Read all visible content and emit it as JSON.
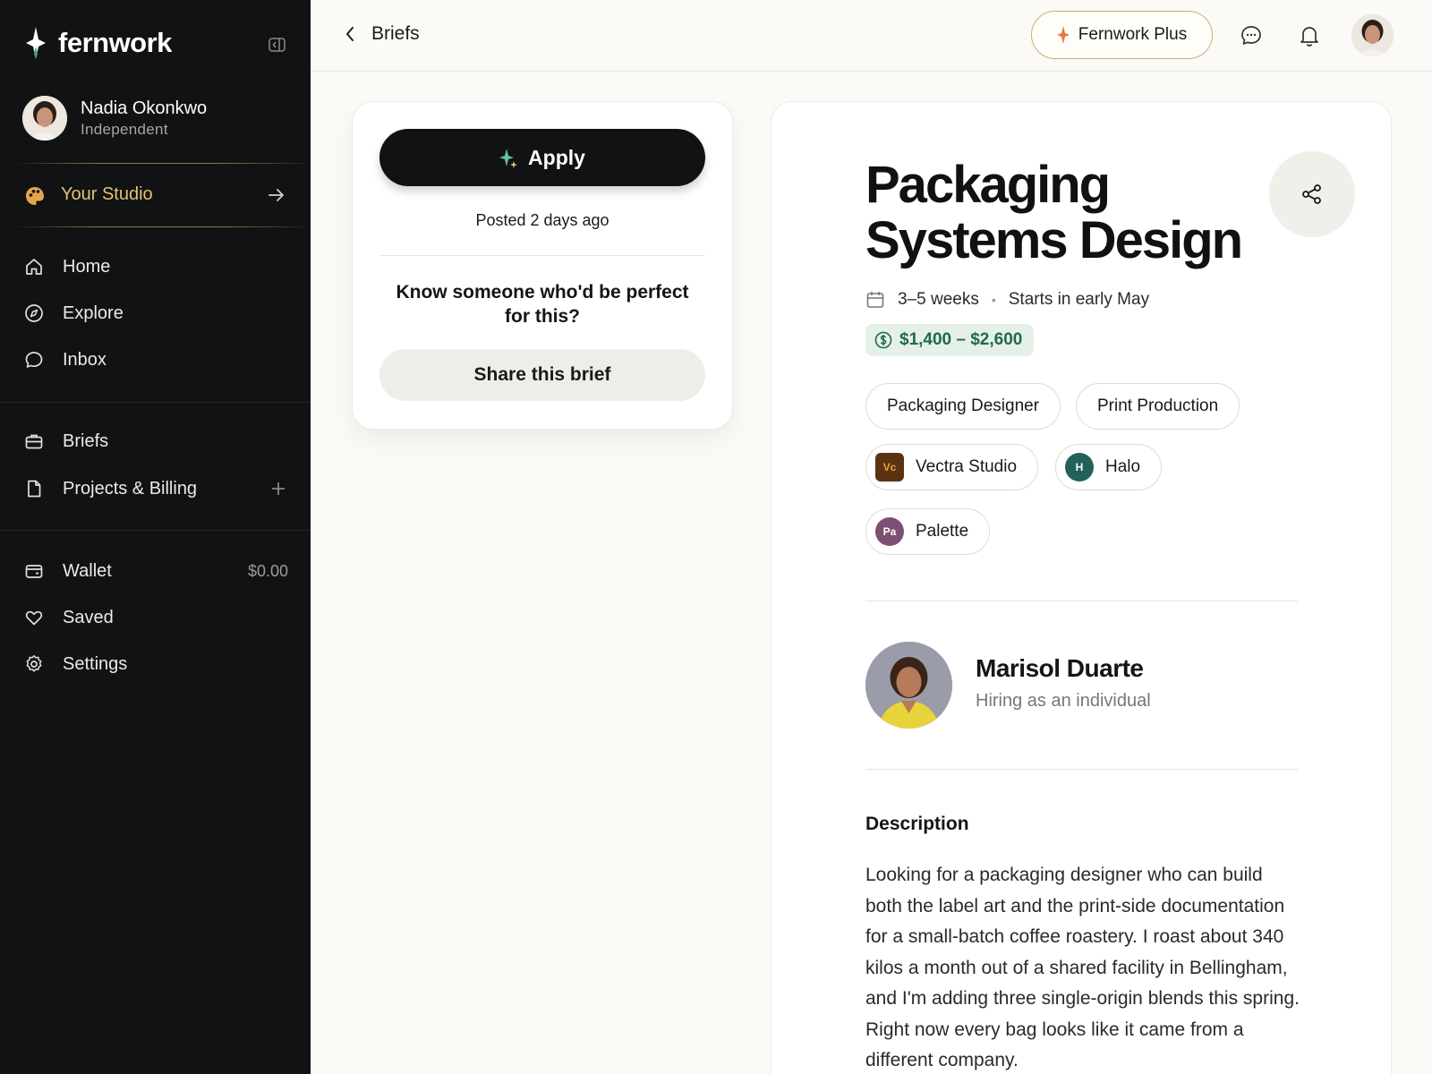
{
  "app": {
    "name": "fernwork"
  },
  "user": {
    "name": "Nadia Okonkwo",
    "role": "Independent"
  },
  "studio": {
    "label": "Your Studio"
  },
  "nav": {
    "primary": [
      {
        "label": "Home",
        "icon": "home-icon"
      },
      {
        "label": "Explore",
        "icon": "compass-icon"
      },
      {
        "label": "Inbox",
        "icon": "chat-icon"
      }
    ],
    "work": [
      {
        "label": "Briefs",
        "icon": "briefcase-icon"
      },
      {
        "label": "Projects & Billing",
        "icon": "document-icon"
      }
    ],
    "account": [
      {
        "label": "Wallet",
        "icon": "wallet-icon",
        "value": "$0.00"
      },
      {
        "label": "Saved",
        "icon": "heart-icon"
      },
      {
        "label": "Settings",
        "icon": "gear-icon"
      }
    ]
  },
  "topbar": {
    "back_label": "Briefs",
    "plus_label": "Fernwork Plus"
  },
  "apply_card": {
    "apply_label": "Apply",
    "posted": "Posted 2 days ago",
    "referral_prompt": "Know someone who'd be perfect for this?",
    "share_label": "Share this brief"
  },
  "brief": {
    "title": "Packaging Systems Design",
    "duration": "3–5 weeks",
    "start": "Starts in early May",
    "budget": "$1,400 – $2,600",
    "roles": [
      "Packaging Designer",
      "Print Production"
    ],
    "tools": [
      {
        "initials": "Vc",
        "name": "Vectra Studio",
        "color": "#5a3410",
        "text_color": "#f0a142"
      },
      {
        "initials": "H",
        "name": "Halo",
        "color": "#22605b",
        "text_color": "#ffffff"
      },
      {
        "initials": "Pa",
        "name": "Palette",
        "color": "#7e4f72",
        "text_color": "#ffffff"
      }
    ],
    "client": {
      "name": "Marisol Duarte",
      "role": "Hiring as an individual"
    },
    "description_heading": "Description",
    "description": "Looking for a packaging designer who can build both the label art and the print-side documentation for a small-batch coffee roastery. I roast about 340 kilos a month out of a shared facility in Bellingham, and I'm adding three single-origin blends this spring. Right now every bag looks like it came from a different company."
  },
  "colors": {
    "sidebar_bg": "#111213",
    "accent_gold": "#e3c275",
    "budget_green": "#1f6b45",
    "budget_bg": "#e5f0e9"
  }
}
